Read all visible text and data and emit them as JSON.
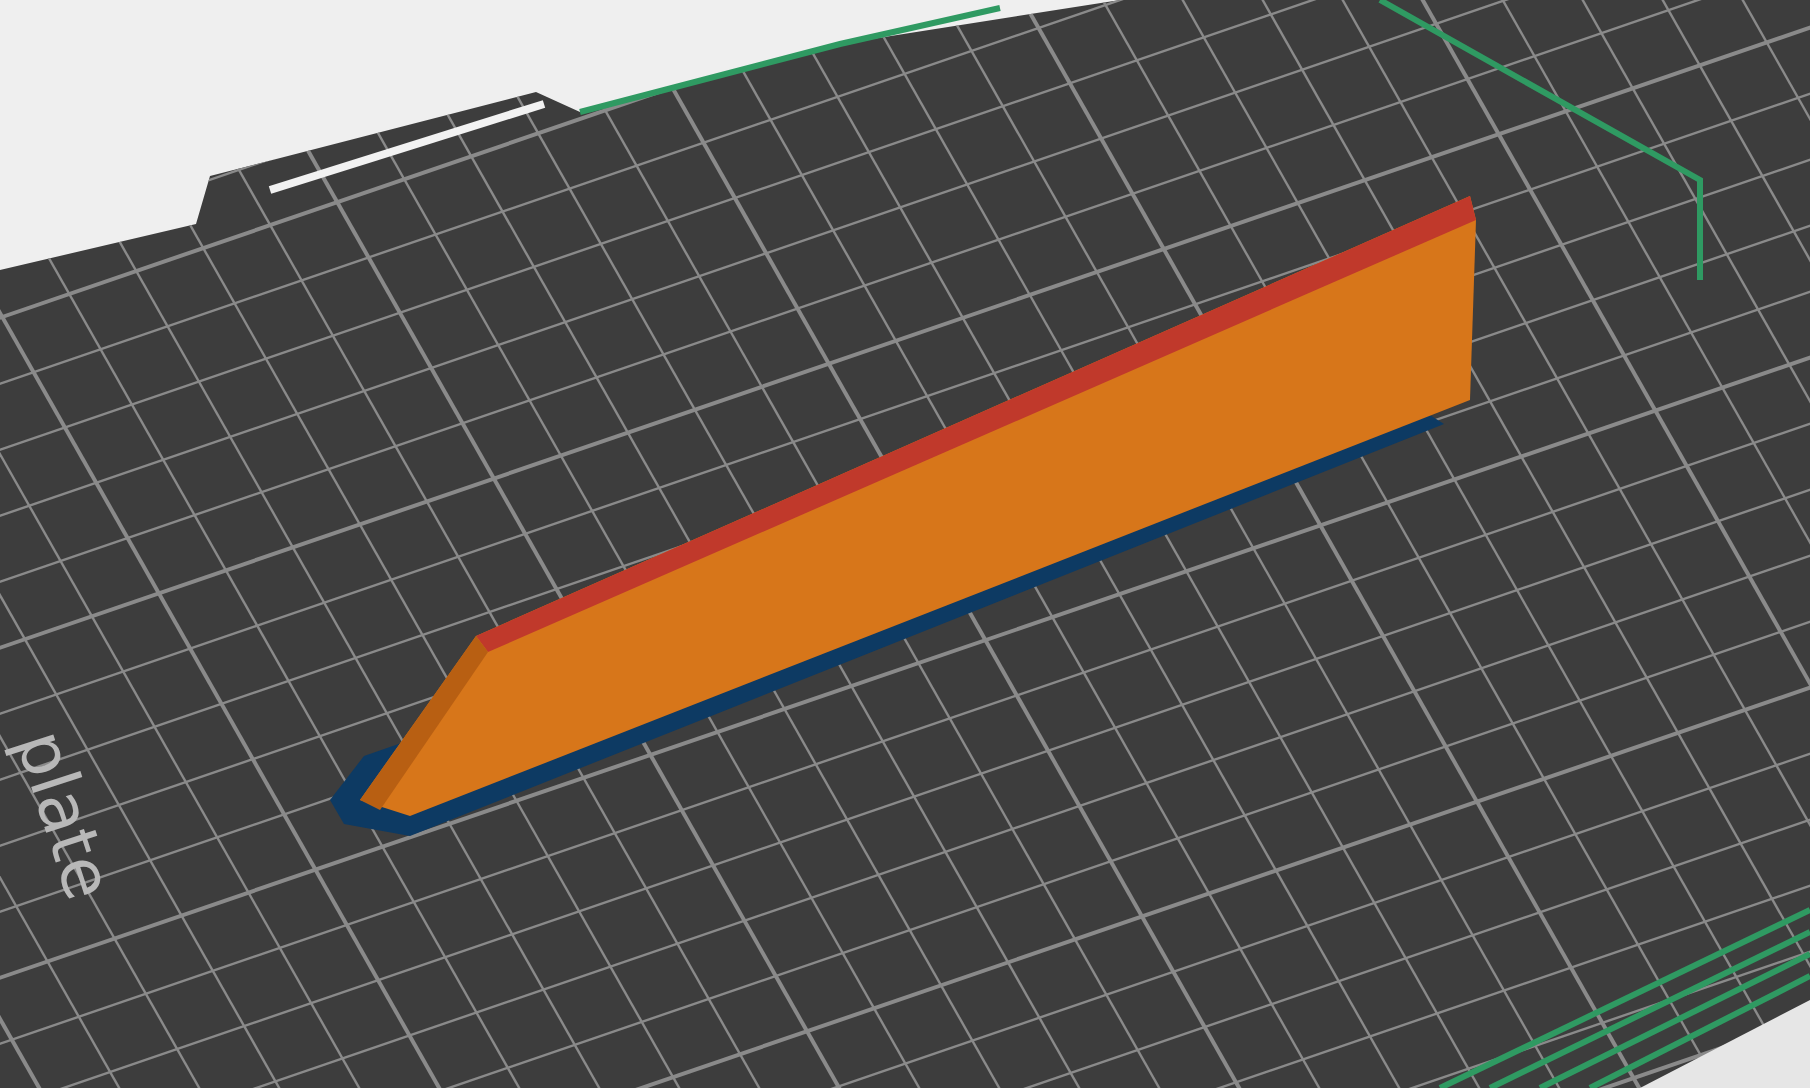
{
  "build_plate": {
    "label": "plate"
  }
}
